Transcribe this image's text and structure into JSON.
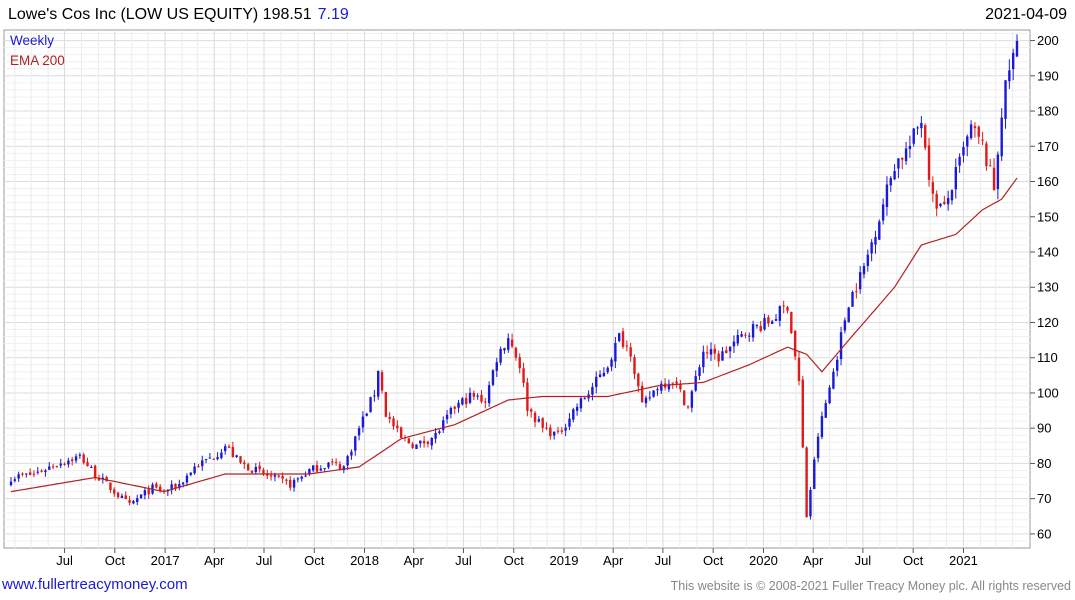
{
  "header": {
    "title": "Lowe's Cos Inc (LOW US EQUITY) 198.51",
    "change": "7.19",
    "date": "2021-04-09"
  },
  "footer": {
    "link": "www.fullertreacymoney.com",
    "copyright": "This website is © 2008-2021 Fuller Treacy Money plc. All rights reserved"
  },
  "chart_data": {
    "type": "candlestick",
    "legend": [
      {
        "label": "Weekly",
        "color": "#1a1ad6"
      },
      {
        "label": "EMA 200",
        "color": "#b22222"
      }
    ],
    "colors": {
      "up": "#1a1ad6",
      "down": "#e01a1a",
      "ema": "#b22222",
      "grid": "#dcdcdc"
    },
    "x_ticks": [
      "Jul",
      "Oct",
      "2017",
      "Apr",
      "Jul",
      "Oct",
      "2018",
      "Apr",
      "Jul",
      "Oct",
      "2019",
      "Apr",
      "Jul",
      "Oct",
      "2020",
      "Apr",
      "Jul",
      "Oct",
      "2021"
    ],
    "y_ticks": [
      60,
      70,
      80,
      90,
      100,
      110,
      120,
      130,
      140,
      150,
      160,
      170,
      180,
      190,
      200
    ],
    "ylim": [
      56,
      203
    ],
    "x_range": [
      "2016-03-25",
      "2021-04-09"
    ],
    "grid": true,
    "close_points": [
      [
        "2016-03-25",
        76
      ],
      [
        "2016-05-06",
        77
      ],
      [
        "2016-06-17",
        80
      ],
      [
        "2016-07-29",
        82
      ],
      [
        "2016-08-26",
        77
      ],
      [
        "2016-09-30",
        72
      ],
      [
        "2016-10-28",
        68
      ],
      [
        "2016-11-11",
        70
      ],
      [
        "2016-12-09",
        73
      ],
      [
        "2016-12-30",
        72
      ],
      [
        "2017-01-27",
        74
      ],
      [
        "2017-02-24",
        79
      ],
      [
        "2017-03-31",
        82
      ],
      [
        "2017-04-21",
        85
      ],
      [
        "2017-05-19",
        80
      ],
      [
        "2017-06-16",
        78
      ],
      [
        "2017-07-14",
        76
      ],
      [
        "2017-08-18",
        74
      ],
      [
        "2017-09-22",
        78
      ],
      [
        "2017-10-27",
        80
      ],
      [
        "2017-11-24",
        79
      ],
      [
        "2017-12-22",
        90
      ],
      [
        "2018-01-19",
        100
      ],
      [
        "2018-01-26",
        107
      ],
      [
        "2018-02-09",
        94
      ],
      [
        "2018-03-09",
        87
      ],
      [
        "2018-04-06",
        85
      ],
      [
        "2018-05-11",
        88
      ],
      [
        "2018-06-15",
        96
      ],
      [
        "2018-07-13",
        99
      ],
      [
        "2018-08-10",
        98
      ],
      [
        "2018-08-31",
        110
      ],
      [
        "2018-09-21",
        116
      ],
      [
        "2018-10-12",
        108
      ],
      [
        "2018-10-26",
        96
      ],
      [
        "2018-11-23",
        90
      ],
      [
        "2018-12-21",
        88
      ],
      [
        "2019-01-18",
        95
      ],
      [
        "2019-02-15",
        100
      ],
      [
        "2019-03-22",
        108
      ],
      [
        "2019-04-12",
        116
      ],
      [
        "2019-05-03",
        112
      ],
      [
        "2019-05-24",
        96
      ],
      [
        "2019-06-21",
        102
      ],
      [
        "2019-07-19",
        104
      ],
      [
        "2019-08-16",
        96
      ],
      [
        "2019-09-13",
        112
      ],
      [
        "2019-10-11",
        110
      ],
      [
        "2019-11-08",
        114
      ],
      [
        "2019-12-06",
        118
      ],
      [
        "2020-01-10",
        120
      ],
      [
        "2020-02-14",
        125
      ],
      [
        "2020-03-06",
        103
      ],
      [
        "2020-03-20",
        65
      ],
      [
        "2020-04-10",
        88
      ],
      [
        "2020-05-08",
        106
      ],
      [
        "2020-06-05",
        126
      ],
      [
        "2020-07-02",
        135
      ],
      [
        "2020-07-31",
        150
      ],
      [
        "2020-08-28",
        165
      ],
      [
        "2020-09-25",
        170
      ],
      [
        "2020-10-16",
        178
      ],
      [
        "2020-11-06",
        155
      ],
      [
        "2020-11-27",
        152
      ],
      [
        "2020-12-18",
        162
      ],
      [
        "2021-01-15",
        175
      ],
      [
        "2021-02-05",
        170
      ],
      [
        "2021-02-26",
        158
      ],
      [
        "2021-03-12",
        180
      ],
      [
        "2021-03-26",
        192
      ],
      [
        "2021-04-09",
        198.51
      ]
    ],
    "ema_points": [
      [
        "2016-03-25",
        72
      ],
      [
        "2016-08-26",
        76
      ],
      [
        "2016-12-30",
        72
      ],
      [
        "2017-04-21",
        77
      ],
      [
        "2017-09-22",
        77
      ],
      [
        "2017-12-22",
        79
      ],
      [
        "2018-03-09",
        87
      ],
      [
        "2018-06-15",
        91
      ],
      [
        "2018-09-21",
        98
      ],
      [
        "2018-11-23",
        99
      ],
      [
        "2019-03-22",
        99
      ],
      [
        "2019-06-21",
        102
      ],
      [
        "2019-09-13",
        103
      ],
      [
        "2019-12-06",
        108
      ],
      [
        "2020-02-14",
        113
      ],
      [
        "2020-03-20",
        111
      ],
      [
        "2020-04-17",
        106
      ],
      [
        "2020-06-05",
        115
      ],
      [
        "2020-08-28",
        130
      ],
      [
        "2020-10-16",
        142
      ],
      [
        "2020-12-18",
        145
      ],
      [
        "2021-02-05",
        152
      ],
      [
        "2021-03-12",
        155
      ],
      [
        "2021-04-09",
        161
      ]
    ]
  }
}
